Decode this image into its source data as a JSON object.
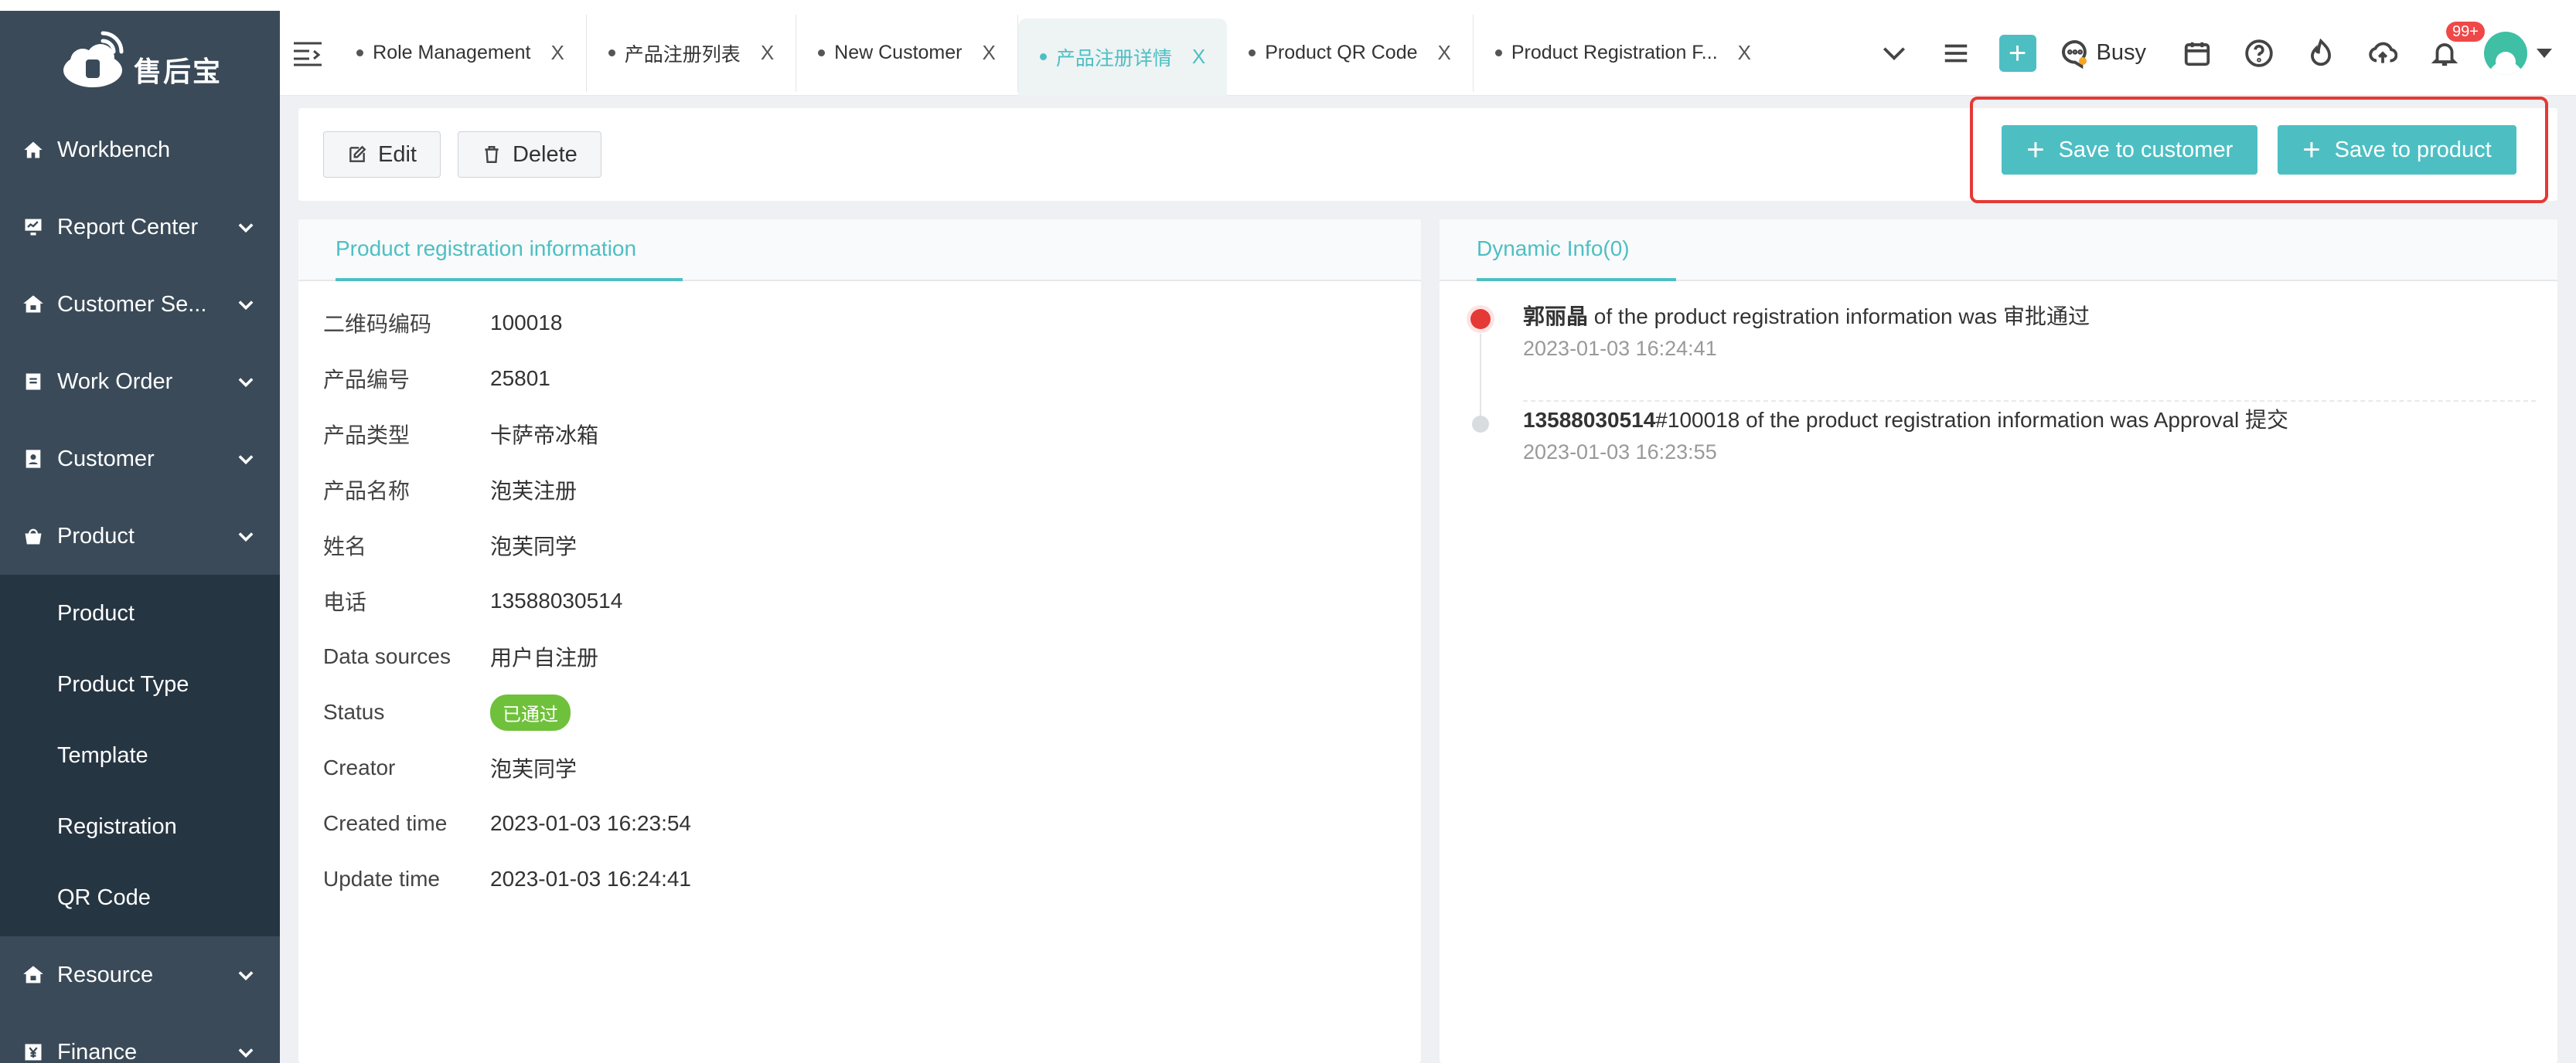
{
  "app": {
    "logo_text": "售后宝"
  },
  "sidebar": {
    "items": [
      {
        "label": "Workbench",
        "icon": "home-icon",
        "expandable": false
      },
      {
        "label": "Report Center",
        "icon": "report-icon",
        "expandable": true
      },
      {
        "label": "Customer Se...",
        "icon": "customer-service-icon",
        "expandable": true
      },
      {
        "label": "Work Order",
        "icon": "work-order-icon",
        "expandable": true
      },
      {
        "label": "Customer",
        "icon": "customer-icon",
        "expandable": true
      },
      {
        "label": "Product",
        "icon": "product-icon",
        "expandable": true,
        "expanded": true
      },
      {
        "label": "Resource",
        "icon": "resource-icon",
        "expandable": true
      },
      {
        "label": "Finance",
        "icon": "finance-icon",
        "expandable": true
      }
    ],
    "product_submenu": [
      "Product",
      "Product Type",
      "Template",
      "Registration",
      "QR Code"
    ]
  },
  "tabs": [
    {
      "label": "Role Management",
      "active": false
    },
    {
      "label": "产品注册列表",
      "active": false
    },
    {
      "label": "New Customer",
      "active": false
    },
    {
      "label": "产品注册详情",
      "active": true
    },
    {
      "label": "Product QR Code",
      "active": false
    },
    {
      "label": "Product Registration F...",
      "active": false
    }
  ],
  "tab_close": "X",
  "topbar": {
    "add_label": "+",
    "status_label": "Busy",
    "notification_badge": "99+"
  },
  "actions": {
    "edit_label": "Edit",
    "delete_label": "Delete",
    "save_customer_label": "Save to customer",
    "save_product_label": "Save to product"
  },
  "registration": {
    "tab_label": "Product registration information",
    "fields": [
      {
        "key": "二维码编码",
        "value": "100018"
      },
      {
        "key": "产品编号",
        "value": "25801"
      },
      {
        "key": "产品类型",
        "value": "卡萨帝冰箱"
      },
      {
        "key": "产品名称",
        "value": "泡芙注册"
      },
      {
        "key": "姓名",
        "value": "泡芙同学"
      },
      {
        "key": "电话",
        "value": "13588030514"
      },
      {
        "key": "Data sources",
        "value": "用户自注册"
      },
      {
        "key": "Status",
        "value": "已通过"
      },
      {
        "key": "Creator",
        "value": "泡芙同学"
      },
      {
        "key": "Created time",
        "value": "2023-01-03 16:23:54"
      },
      {
        "key": "Update time",
        "value": "2023-01-03 16:24:41"
      }
    ]
  },
  "dynamic": {
    "tab_label": "Dynamic Info(0)",
    "events": [
      {
        "actor": "郭丽晶",
        "text": " of the product registration information was 审批通过",
        "time": "2023-01-03 16:24:41"
      },
      {
        "actor": "13588030514",
        "text": "#100018 of the product registration information was Approval 提交",
        "time": "2023-01-03 16:23:55"
      }
    ]
  },
  "colors": {
    "accent": "#4dbfc3",
    "sidebar": "#3a4a58",
    "submenu": "#263542",
    "highlight": "#e53935",
    "success": "#6fc13b"
  }
}
